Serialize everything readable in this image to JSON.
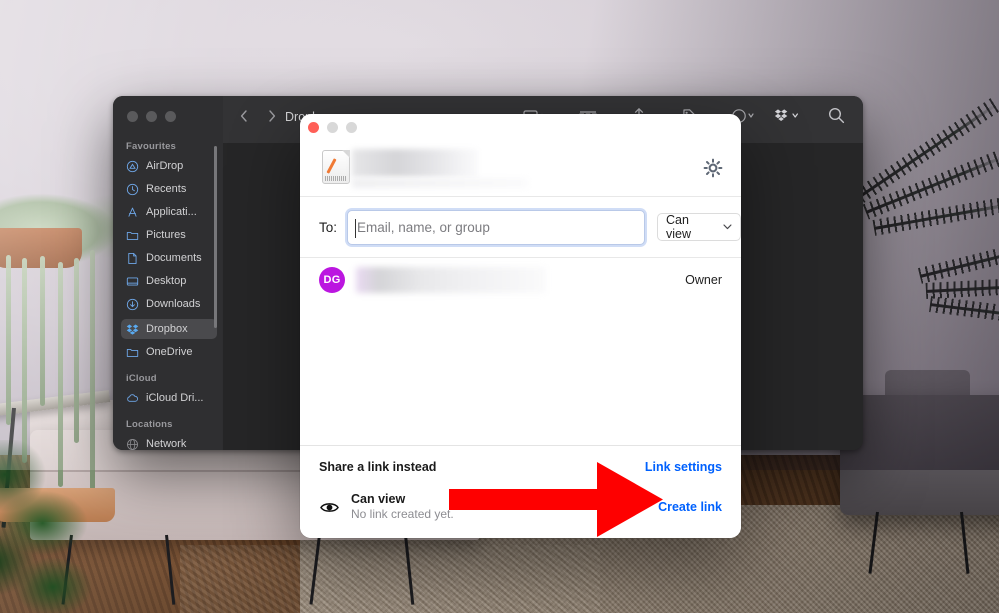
{
  "desktop": {
    "wallpaper_description": "living room with sofa, hanging plant, monstera, palm, wooden floor and rug"
  },
  "finder": {
    "window_title": "Dropbox",
    "traffic_lights": [
      "close",
      "minimize",
      "zoom"
    ],
    "toolbar": {
      "back_icon": "chevron-left-icon",
      "forward_icon": "chevron-right-icon",
      "view_icon": "view-mode-icon",
      "group_icon": "group-by-icon",
      "share_icon": "share-icon",
      "tag_icon": "tag-icon",
      "action_icon": "action-more-icon",
      "dropbox_icon": "dropbox-icon",
      "search_icon": "search-icon"
    },
    "sidebar": {
      "sections": [
        {
          "header": "Favourites",
          "items": [
            {
              "label": "AirDrop",
              "icon": "airdrop-icon",
              "selected": false
            },
            {
              "label": "Recents",
              "icon": "clock-icon",
              "selected": false
            },
            {
              "label": "Applicati...",
              "icon": "applications-icon",
              "selected": false
            },
            {
              "label": "Pictures",
              "icon": "pictures-folder-icon",
              "selected": false
            },
            {
              "label": "Documents",
              "icon": "documents-folder-icon",
              "selected": false
            },
            {
              "label": "Desktop",
              "icon": "desktop-icon",
              "selected": false
            },
            {
              "label": "Downloads",
              "icon": "downloads-icon",
              "selected": false
            },
            {
              "label": "Dropbox",
              "icon": "dropbox-icon",
              "selected": true
            },
            {
              "label": "OneDrive",
              "icon": "onedrive-folder-icon",
              "selected": false
            }
          ]
        },
        {
          "header": "iCloud",
          "items": [
            {
              "label": "iCloud Dri...",
              "icon": "icloud-icon",
              "selected": false
            }
          ]
        },
        {
          "header": "Locations",
          "items": [
            {
              "label": "Network",
              "icon": "network-globe-icon",
              "selected": false
            }
          ]
        }
      ]
    }
  },
  "share_dialog": {
    "traffic_lights": [
      "close",
      "minimize",
      "zoom"
    ],
    "file_icon": "pages-document-icon",
    "file_name_redacted": true,
    "settings_icon": "gear-icon",
    "to": {
      "label": "To:",
      "placeholder": "Email, name, or group",
      "value": "",
      "permission": "Can view",
      "permission_chevron": "chevron-down-icon"
    },
    "people": [
      {
        "avatar_initials": "DG",
        "avatar_color": "#bb16e0",
        "name_redacted": true,
        "role": "Owner"
      }
    ],
    "footer": {
      "title": "Share a link instead",
      "link_settings": "Link settings",
      "visibility_icon": "eye-icon",
      "permission": "Can view",
      "status": "No link created yet.",
      "create_link": "Create link",
      "link_color": "#0061fe"
    }
  },
  "annotation": {
    "arrow": {
      "color": "#fe0000",
      "direction": "right",
      "points_to": "Create link"
    }
  }
}
